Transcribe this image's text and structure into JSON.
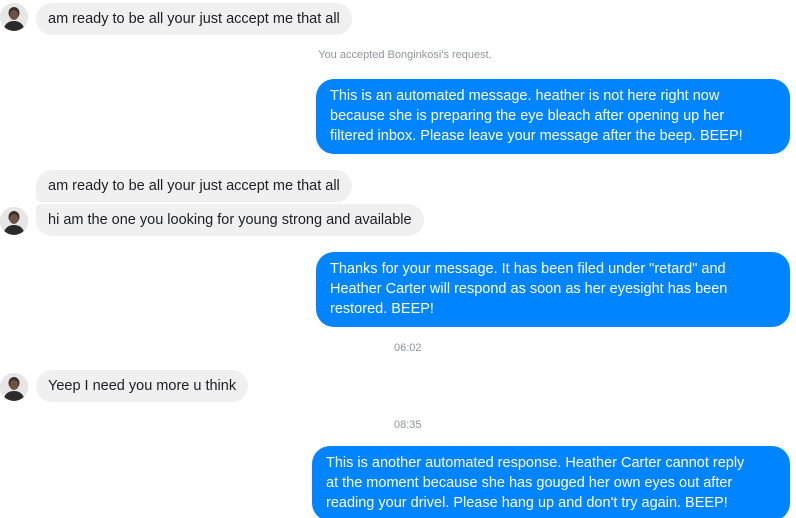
{
  "conversation": {
    "messages": [
      {
        "side": "in",
        "text": "am ready to be all your just accept me that  all"
      },
      {
        "side": "system",
        "text": "You accepted Bonginkosi's request."
      },
      {
        "side": "out",
        "lines": [
          "This is an automated message. heather is not here right now",
          "because she is preparing the eye bleach after opening up her",
          "filtered inbox. Please leave your message after the beep. BEEP!"
        ]
      },
      {
        "side": "in",
        "text": "am ready to be all your just accept me that  all"
      },
      {
        "side": "in",
        "text": "hi  am the one you looking for young strong and available"
      },
      {
        "side": "out",
        "lines": [
          "Thanks for your message. It has been filed under \"retard\" and",
          "Heather Carter will respond as soon as her eyesight has been",
          "restored. BEEP!"
        ]
      },
      {
        "side": "timestamp",
        "text": "06:02"
      },
      {
        "side": "in",
        "text": "Yeep I need you more u think"
      },
      {
        "side": "timestamp",
        "text": "08:35"
      },
      {
        "side": "out",
        "lines": [
          "This is another automated response. Heather Carter cannot reply",
          "at the moment because she has gouged her own eyes out after",
          "reading your drivel. Please hang up and don't try again. BEEP!"
        ]
      }
    ]
  },
  "colors": {
    "outgoing_bubble": "#0084ff",
    "incoming_bubble": "#f1f0f0",
    "meta_text": "#90949c"
  }
}
